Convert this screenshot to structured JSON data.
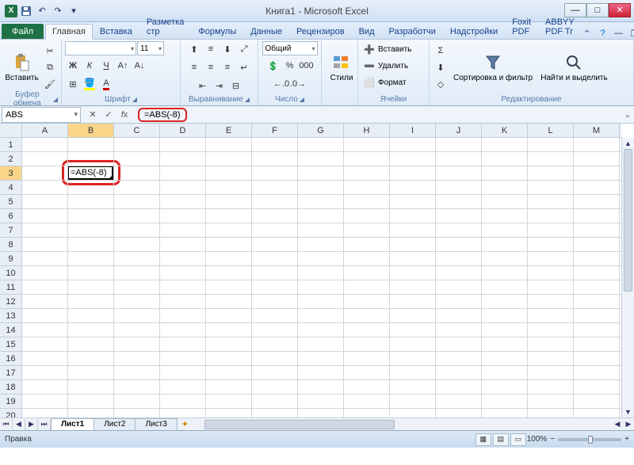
{
  "window": {
    "title": "Книга1 - Microsoft Excel"
  },
  "qat": {
    "app_icon_letter": "X"
  },
  "tabs": {
    "file": "Файл",
    "items": [
      "Главная",
      "Вставка",
      "Разметка стр",
      "Формулы",
      "Данные",
      "Рецензиров",
      "Вид",
      "Разработчи",
      "Надстройки",
      "Foxit PDF",
      "ABBYY PDF Tr"
    ],
    "active_index": 0
  },
  "ribbon": {
    "clipboard": {
      "label": "Буфер обмена",
      "paste": "Вставить"
    },
    "font": {
      "label": "Шрифт",
      "font_name": "",
      "font_size": "11"
    },
    "alignment": {
      "label": "Выравнивание"
    },
    "number": {
      "label": "Число",
      "format": "Общий"
    },
    "styles": {
      "label": "",
      "styles_btn": "Стили"
    },
    "cells": {
      "label": "Ячейки",
      "insert": "Вставить",
      "delete": "Удалить",
      "format": "Формат"
    },
    "editing": {
      "label": "Редактирование",
      "sort": "Сортировка и фильтр",
      "find": "Найти и выделить"
    }
  },
  "formula_bar": {
    "name_box": "ABS",
    "formula": "=ABS(-8)"
  },
  "grid": {
    "columns": [
      "A",
      "B",
      "C",
      "D",
      "E",
      "F",
      "G",
      "H",
      "I",
      "J",
      "K",
      "L",
      "M"
    ],
    "active_col_index": 1,
    "row_count": 20,
    "active_row": 3,
    "active_cell_value": "=ABS(-8)"
  },
  "sheets": {
    "items": [
      "Лист1",
      "Лист2",
      "Лист3"
    ],
    "active_index": 0
  },
  "status": {
    "mode": "Правка",
    "zoom": "100%"
  }
}
